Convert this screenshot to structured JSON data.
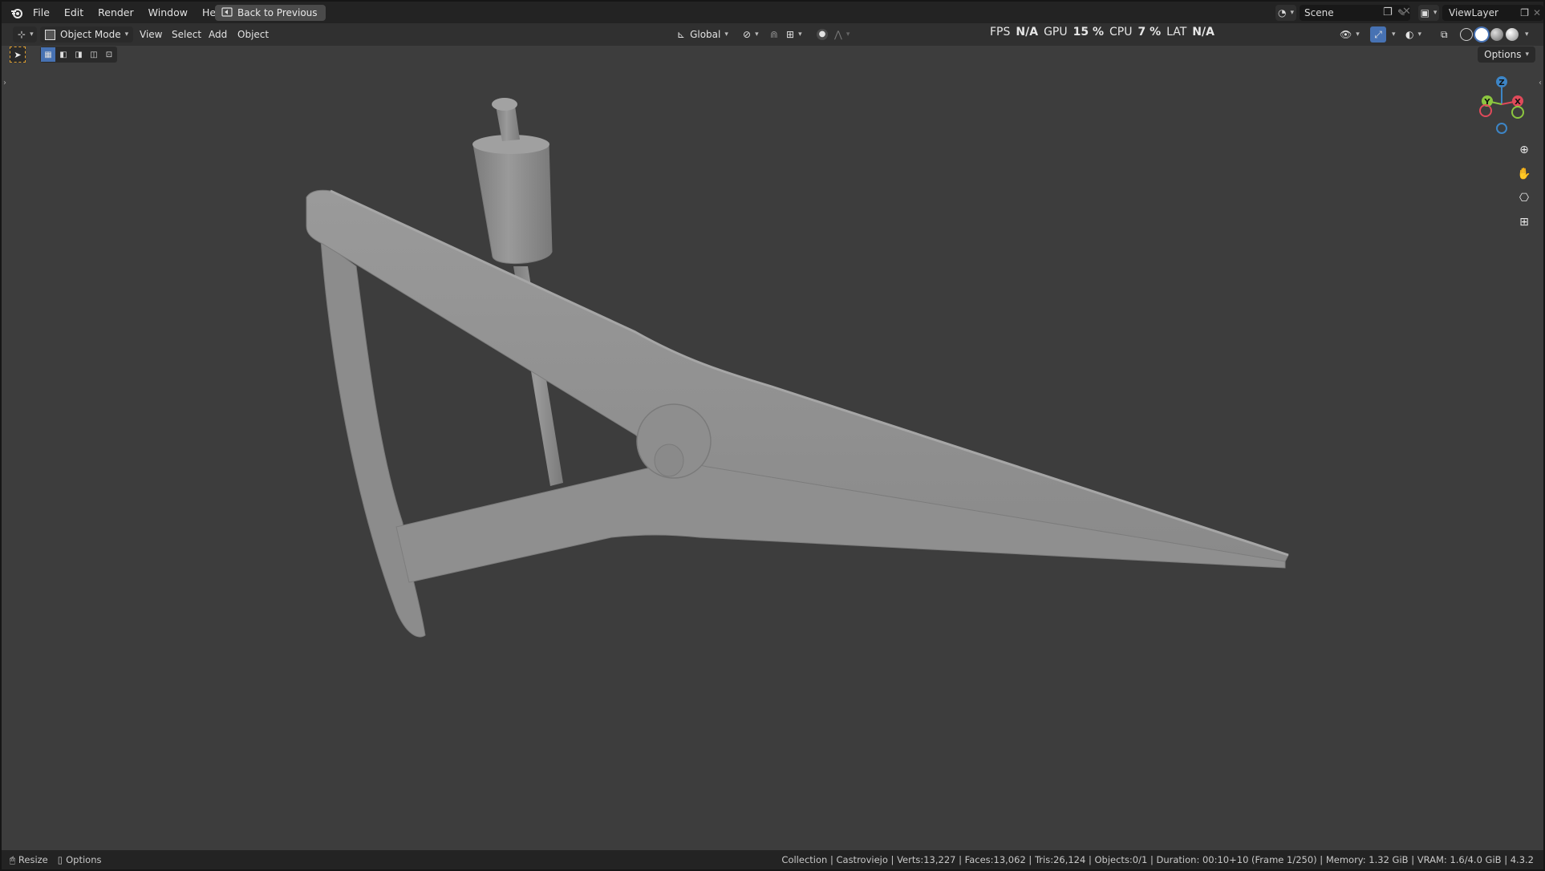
{
  "menu": {
    "file": "File",
    "edit": "Edit",
    "render": "Render",
    "window": "Window",
    "help": "Help"
  },
  "back_button": "Back to Previous",
  "scene": "Scene",
  "view_layer": "ViewLayer",
  "header": {
    "mode": "Object Mode",
    "view": "View",
    "select": "Select",
    "add": "Add",
    "object": "Object",
    "orientation": "Global"
  },
  "stats": {
    "fps_label": "FPS",
    "fps_value": "N/A",
    "gpu_label": "GPU",
    "gpu_value": "15 %",
    "cpu_label": "CPU",
    "cpu_value": "7 %",
    "lat_label": "LAT",
    "lat_value": "N/A"
  },
  "options_label": "Options",
  "gizmo": {
    "z": "Z",
    "y": "Y",
    "x": "X"
  },
  "colors": {
    "accent": "#4772b3",
    "axis_x": "#e04a5a",
    "axis_y": "#8cc63f",
    "axis_z": "#3d85c6",
    "model": "#8e8e8e"
  },
  "icons": [
    "blender-icon",
    "zoom-icon",
    "hand-icon",
    "camera-icon",
    "grid-icon"
  ],
  "statusbar": {
    "resize": "Resize",
    "options": "Options",
    "info": "Collection | Castroviejo | Verts:13,227 | Faces:13,062 | Tris:26,124 | Objects:0/1 | Duration: 00:10+10 (Frame 1/250) | Memory: 1.32 GiB | VRAM: 1.6/4.0 GiB | 4.3.2"
  }
}
